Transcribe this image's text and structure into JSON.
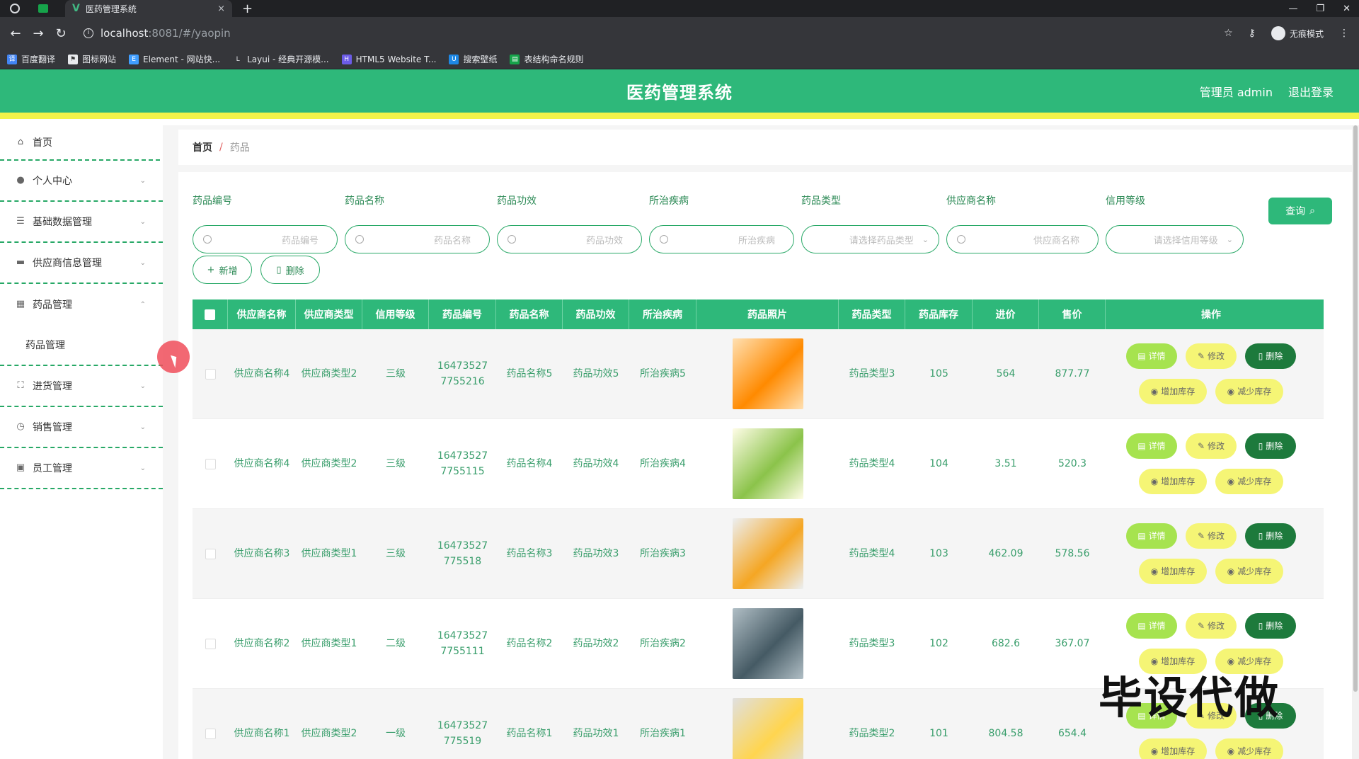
{
  "browser": {
    "tab_title": "医药管理系统",
    "tab_close": "×",
    "new_tab": "+",
    "url_host": "localhost",
    "url_path": ":8081/#/yaopin",
    "incognito_label": "无痕模式",
    "bookmarks": [
      {
        "label": "百度翻译"
      },
      {
        "label": "图标网站"
      },
      {
        "label": "Element - 网站快..."
      },
      {
        "label": "Layui - 经典开源模..."
      },
      {
        "label": "HTML5 Website T..."
      },
      {
        "label": "搜索壁纸"
      },
      {
        "label": "表结构命名规则"
      }
    ]
  },
  "header": {
    "title": "医药管理系统",
    "user": "管理员 admin",
    "logout": "退出登录",
    "colors": {
      "primary": "#2eb87a",
      "accent": "#f3f349"
    }
  },
  "sidebar": {
    "items": [
      {
        "label": "首页",
        "icon": "home-icon"
      },
      {
        "label": "个人中心",
        "icon": "user-icon"
      },
      {
        "label": "基础数据管理",
        "icon": "list-icon"
      },
      {
        "label": "供应商信息管理",
        "icon": "folder-icon"
      },
      {
        "label": "药品管理",
        "icon": "box-icon",
        "expanded": true,
        "children": [
          {
            "label": "药品管理"
          }
        ]
      },
      {
        "label": "进货管理",
        "icon": "scan-icon"
      },
      {
        "label": "销售管理",
        "icon": "clock-icon"
      },
      {
        "label": "员工管理",
        "icon": "trash-icon"
      }
    ]
  },
  "breadcrumb": {
    "home": "首页",
    "separator": "/",
    "current": "药品"
  },
  "search": {
    "fields": [
      {
        "label": "药品编号",
        "placeholder": "药品编号"
      },
      {
        "label": "药品名称",
        "placeholder": "药品名称"
      },
      {
        "label": "药品功效",
        "placeholder": "药品功效"
      },
      {
        "label": "所治疾病",
        "placeholder": "所治疾病"
      },
      {
        "label": "药品类型",
        "placeholder": "请选择药品类型"
      },
      {
        "label": "供应商名称",
        "placeholder": "供应商名称"
      },
      {
        "label": "信用等级",
        "placeholder": "请选择信用等级"
      }
    ],
    "query_label": "查询"
  },
  "actions": {
    "add_label": "新增",
    "delete_label": "删除"
  },
  "table": {
    "columns": [
      "供应商名称",
      "供应商类型",
      "信用等级",
      "药品编号",
      "药品名称",
      "药品功效",
      "所治疾病",
      "药品照片",
      "药品类型",
      "药品库存",
      "进价",
      "售价",
      "操作"
    ],
    "op_labels": {
      "detail": "详情",
      "edit": "修改",
      "delete": "删除",
      "increase": "增加库存",
      "decrease": "减少库存"
    },
    "rows": [
      {
        "supplier": "供应商名称4",
        "supplier_type": "供应商类型2",
        "credit": "三级",
        "code": "16473527 7755216",
        "name": "药品名称5",
        "effect": "药品功效5",
        "disease": "所治疾病5",
        "photo_colors": [
          "#ff8a00",
          "#ffe0b2"
        ],
        "type": "药品类型3",
        "stock": "105",
        "cost": "564",
        "price": "877.77"
      },
      {
        "supplier": "供应商名称4",
        "supplier_type": "供应商类型2",
        "credit": "三级",
        "code": "16473527 7755115",
        "name": "药品名称4",
        "effect": "药品功效4",
        "disease": "所治疾病4",
        "photo_colors": [
          "#8bc34a",
          "#fffde7"
        ],
        "type": "药品类型4",
        "stock": "104",
        "cost": "3.51",
        "price": "520.3"
      },
      {
        "supplier": "供应商名称3",
        "supplier_type": "供应商类型1",
        "credit": "三级",
        "code": "16473527 775518",
        "name": "药品名称3",
        "effect": "药品功效3",
        "disease": "所治疾病3",
        "photo_colors": [
          "#f5a623",
          "#eceff1"
        ],
        "type": "药品类型4",
        "stock": "103",
        "cost": "462.09",
        "price": "578.56"
      },
      {
        "supplier": "供应商名称2",
        "supplier_type": "供应商类型1",
        "credit": "二级",
        "code": "16473527 7755111",
        "name": "药品名称2",
        "effect": "药品功效2",
        "disease": "所治疾病2",
        "photo_colors": [
          "#455a64",
          "#b0bec5"
        ],
        "type": "药品类型3",
        "stock": "102",
        "cost": "682.6",
        "price": "367.07"
      },
      {
        "supplier": "供应商名称1",
        "supplier_type": "供应商类型2",
        "credit": "一级",
        "code": "16473527 775519",
        "name": "药品名称1",
        "effect": "药品功效1",
        "disease": "所治疾病1",
        "photo_colors": [
          "#ffd54f",
          "#e0e0e0"
        ],
        "type": "药品类型2",
        "stock": "101",
        "cost": "804.58",
        "price": "654.4"
      }
    ]
  },
  "watermark": "毕设代做"
}
